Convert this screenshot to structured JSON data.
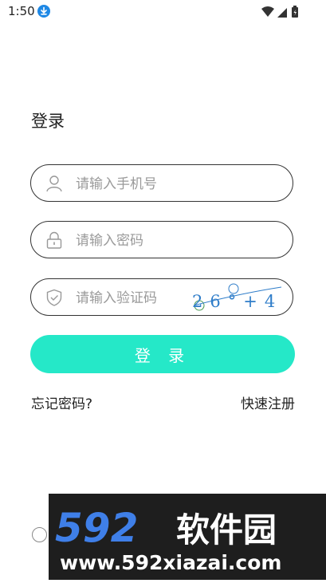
{
  "status_bar": {
    "time": "1:50"
  },
  "login": {
    "title": "登录",
    "phone_placeholder": "请输入手机号",
    "password_placeholder": "请输入密码",
    "code_placeholder": "请输入验证码",
    "captcha_text": "26°+40",
    "submit_label": "登 录",
    "forgot_label": "忘记密码?",
    "register_label": "快速注册"
  },
  "watermark": {
    "brand": "592软件园",
    "url": "www.592xiazai.com"
  },
  "colors": {
    "accent": "#25e8c8",
    "captcha_blue": "#2f7dc9",
    "captcha_green": "#4a9a55"
  }
}
